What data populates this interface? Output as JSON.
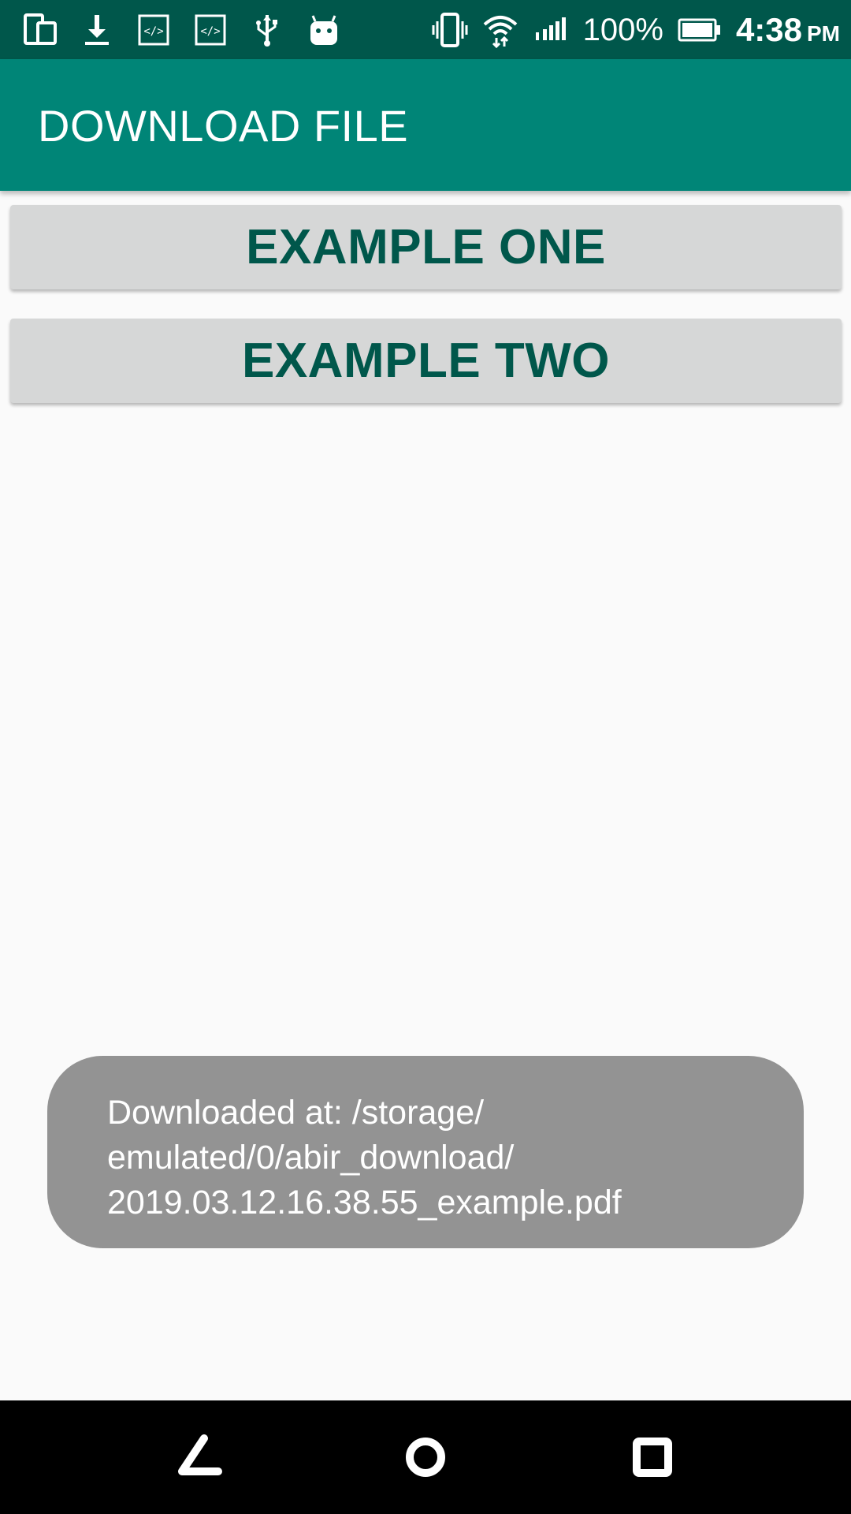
{
  "status_bar": {
    "battery_percent": "100%",
    "time": "4:38",
    "ampm": "PM",
    "left_icons": [
      "phone-tablet-icon",
      "download-icon",
      "code-icon",
      "code-icon",
      "usb-icon",
      "android-icon"
    ],
    "right_icons": [
      "vibrate-icon",
      "wifi-icon",
      "signal-icon",
      "battery-icon"
    ]
  },
  "app_bar": {
    "title": "DOWNLOAD FILE"
  },
  "buttons": {
    "example_one": "EXAMPLE ONE",
    "example_two": "EXAMPLE TWO"
  },
  "toast": {
    "lines": [
      "Downloaded at: /storage/",
      "emulated/0/abir_download/",
      "2019.03.12.16.38.55_example.pdf"
    ]
  },
  "nav_bar": {
    "icons": [
      "back-icon",
      "home-icon",
      "recents-icon"
    ]
  },
  "colors": {
    "status_bar": "#00574b",
    "app_bar": "#008577",
    "button_bg": "#d6d7d7",
    "button_text": "#00574b",
    "toast_bg": "#939393"
  }
}
